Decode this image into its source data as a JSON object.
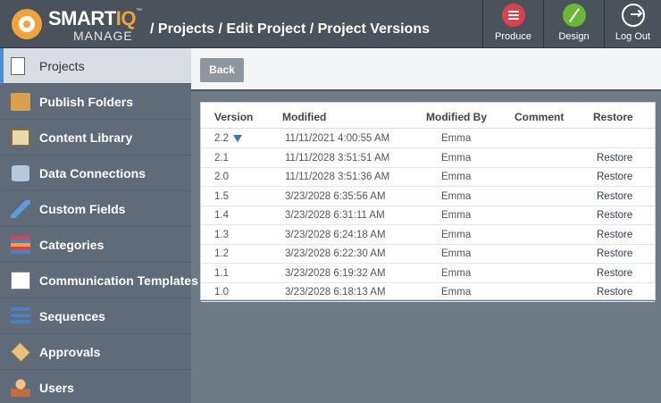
{
  "app": {
    "logo_main": "SMART",
    "logo_accent": "IQ",
    "logo_tm": "™",
    "logo_sub": "MANAGE",
    "breadcrumb": "/ Projects / Edit Project / Project Versions"
  },
  "header_buttons": {
    "produce": "Produce",
    "design": "Design",
    "logout": "Log Out"
  },
  "sidebar": {
    "items": [
      {
        "label": "Projects",
        "icon": "page-icon",
        "active": true
      },
      {
        "label": "Publish Folders",
        "icon": "folder-icon"
      },
      {
        "label": "Content Library",
        "icon": "library-icon"
      },
      {
        "label": "Data Connections",
        "icon": "database-icon"
      },
      {
        "label": "Custom Fields",
        "icon": "pencil-icon"
      },
      {
        "label": "Categories",
        "icon": "categories-icon"
      },
      {
        "label": "Communication Templates",
        "icon": "communication-icon"
      },
      {
        "label": "Sequences",
        "icon": "sequences-icon"
      },
      {
        "label": "Approvals",
        "icon": "approvals-icon"
      },
      {
        "label": "Users",
        "icon": "user-icon"
      }
    ]
  },
  "toolbar": {
    "back_label": "Back"
  },
  "table": {
    "headers": {
      "version": "Version",
      "modified": "Modified",
      "modified_by": "Modified By",
      "comment": "Comment",
      "restore": "Restore"
    },
    "rows": [
      {
        "version": "2.2",
        "modified": "11/11/2021 4:00:55 AM",
        "by": "Emma",
        "comment": "",
        "restore": "",
        "flag": true
      },
      {
        "version": "2.1",
        "modified": "11/11/2028 3:51:51 AM",
        "by": "Emma",
        "comment": "",
        "restore": "Restore"
      },
      {
        "version": "2.0",
        "modified": "11/11/2028 3:51:36 AM",
        "by": "Emma",
        "comment": "",
        "restore": "Restore"
      },
      {
        "version": "1.5",
        "modified": "3/23/2028 6:35:56 AM",
        "by": "Emma",
        "comment": "",
        "restore": "Restore"
      },
      {
        "version": "1.4",
        "modified": "3/23/2028 6:31:11 AM",
        "by": "Emma",
        "comment": "",
        "restore": "Restore"
      },
      {
        "version": "1.3",
        "modified": "3/23/2028 6:24:18 AM",
        "by": "Emma",
        "comment": "",
        "restore": "Restore"
      },
      {
        "version": "1.2",
        "modified": "3/23/2028 6:22:30 AM",
        "by": "Emma",
        "comment": "",
        "restore": "Restore"
      },
      {
        "version": "1.1",
        "modified": "3/23/2028 6:19:32 AM",
        "by": "Emma",
        "comment": "",
        "restore": "Restore"
      },
      {
        "version": "1.0",
        "modified": "3/23/2028 6:18:13 AM",
        "by": "Emma",
        "comment": "",
        "restore": "Restore"
      }
    ]
  },
  "colors": {
    "header_bg": "#4a525b",
    "sidebar_bg": "#5f6b78",
    "accent_orange": "#f0a33a",
    "produce_red": "#d9414c",
    "design_green": "#6ab934"
  }
}
